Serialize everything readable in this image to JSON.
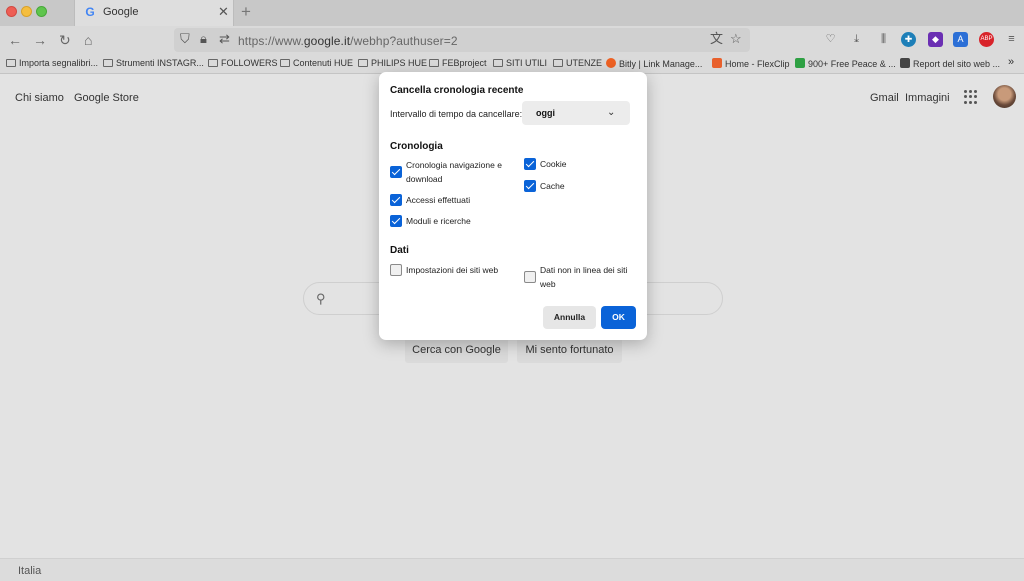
{
  "tab": {
    "title": "Google",
    "favicon": "google-favicon"
  },
  "urlbar": {
    "url_prefix": "https://www.",
    "url_domain": "google.it",
    "url_suffix": "/webhp?authuser=2"
  },
  "bookmarks": [
    {
      "label": "Importa segnalibri...",
      "icon": "import-icon"
    },
    {
      "label": "Strumenti INSTAGR...",
      "icon": "folder-icon"
    },
    {
      "label": "FOLLOWERS",
      "icon": "folder-icon"
    },
    {
      "label": "Contenuti HUE",
      "icon": "folder-icon"
    },
    {
      "label": "PHILIPS HUE",
      "icon": "folder-icon"
    },
    {
      "label": "FEBproject",
      "icon": "folder-icon"
    },
    {
      "label": "SITI UTILI",
      "icon": "folder-icon"
    },
    {
      "label": "UTENZE",
      "icon": "folder-icon"
    },
    {
      "label": "Bitly | Link Manage...",
      "icon": "bitly-icon"
    },
    {
      "label": "Home - FlexClip",
      "icon": "flexclip-icon"
    },
    {
      "label": "900+ Free Peace & ...",
      "icon": "pixabay-icon"
    },
    {
      "label": "Report del sito web ...",
      "icon": "semrush-icon"
    }
  ],
  "page": {
    "left_links": [
      "Chi siamo",
      "Google Store"
    ],
    "right_links": [
      "Gmail",
      "Immagini"
    ],
    "search_button": "Cerca con Google",
    "lucky_button": "Mi sento fortunato",
    "footer_country": "Italia"
  },
  "dialog": {
    "title": "Cancella cronologia recente",
    "range_label": "Intervallo di tempo da cancellare:",
    "range_value": "oggi",
    "history_section": "Cronologia",
    "history_items": [
      {
        "line1": "Cronologia navigazione e",
        "line2": "download",
        "checked": true
      },
      {
        "line1": "Accessi effettuati",
        "line2": "",
        "checked": true
      },
      {
        "line1": "Moduli e ricerche",
        "line2": "",
        "checked": true
      },
      {
        "line1": "Cookie",
        "line2": "",
        "checked": true
      },
      {
        "line1": "Cache",
        "line2": "",
        "checked": true
      }
    ],
    "data_section": "Dati",
    "data_items": [
      {
        "line1": "Impostazioni dei siti web",
        "line2": "",
        "checked": false
      },
      {
        "line1": "Dati non in linea dei siti",
        "line2": "web",
        "checked": false
      }
    ],
    "cancel_label": "Annulla",
    "ok_label": "OK"
  },
  "colors": {
    "accent": "#0a63d8",
    "overlay": "#e3e3e3"
  }
}
